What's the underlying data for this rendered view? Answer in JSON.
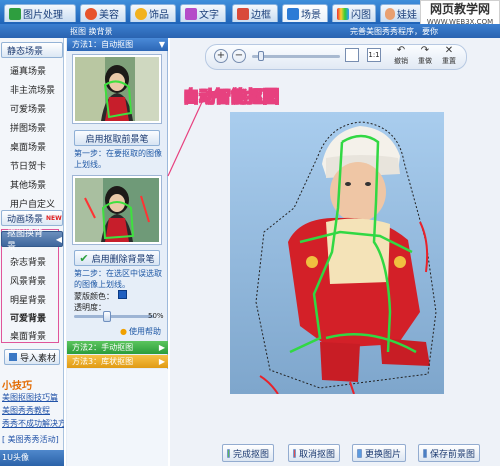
{
  "topbar": {
    "tabs": [
      "图片处理",
      "美容",
      "饰品",
      "文字",
      "边框",
      "场景",
      "闪图",
      "娃娃"
    ],
    "right_text": "打开"
  },
  "watermark": {
    "site": "网页教学网",
    "url": "WWW.WEB3X.COM"
  },
  "subbar": {
    "title": "抠图 换背景",
    "right_text": "完善美图秀秀程序，要你"
  },
  "sidebar": {
    "head_static": "静态场景",
    "static_items": [
      "逼真场景",
      "非主流场景",
      "可爱场景",
      "拼图场景",
      "桌面场景",
      "节日贺卡",
      "其他场景",
      "用户自定义"
    ],
    "head_animated": "动画场景",
    "new_badge": "NEW",
    "head_cutout": "抠图换背景",
    "cutout_items": [
      "杂志背景",
      "风景背景",
      "明星背景",
      "可爱背景",
      "桌面背景"
    ],
    "import_label": "导入素材",
    "tips_title": "小技巧",
    "tips": [
      "美图抠图技巧篇",
      "美图秀秀教程",
      "秀秀不成功解决方法"
    ],
    "news": "[ 美图秀秀活动]",
    "status": "1U头像"
  },
  "method_panel": {
    "method1": "方法1：自动抠图",
    "auto_btn": "启用抠取前景笔",
    "step1": "第一步：在要抠取的图像上划线。",
    "erase_btn": "启用删除背景笔",
    "step2": "第二步：在选区中误选取的图像上划线。",
    "mask_color_label": "蒙版颜色：",
    "opacity_label": "透明度：",
    "opacity_value": "50%",
    "help": "使用帮助",
    "method2": "方法2：手动抠图",
    "method3": "方法3：库状抠图"
  },
  "annotation": "自动智能抠图",
  "toolbar": {
    "undo": "撤销",
    "redo": "重做",
    "reset": "重置"
  },
  "bottom": {
    "done": "完成抠图",
    "cancel": "取消抠图",
    "replace": "更换图片",
    "save": "保存前景图"
  },
  "colors": {
    "accent_blue": "#2f74c8",
    "green_head": "#2fa33f",
    "orange_head": "#e8a018",
    "annotation_pink": "#e7417f",
    "highlight_box": "#e0559a"
  }
}
